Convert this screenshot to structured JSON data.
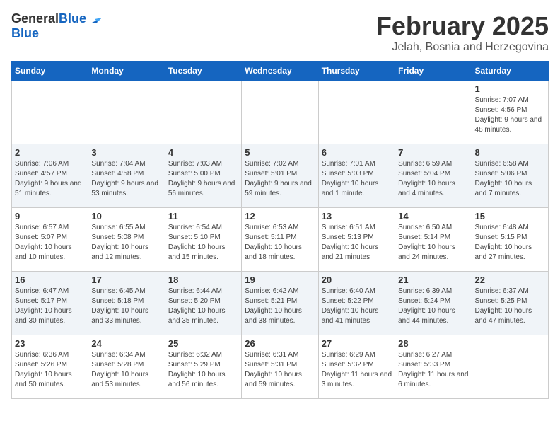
{
  "header": {
    "logo_general": "General",
    "logo_blue": "Blue",
    "month_title": "February 2025",
    "location": "Jelah, Bosnia and Herzegovina"
  },
  "days_of_week": [
    "Sunday",
    "Monday",
    "Tuesday",
    "Wednesday",
    "Thursday",
    "Friday",
    "Saturday"
  ],
  "weeks": [
    [
      {
        "day": "",
        "info": ""
      },
      {
        "day": "",
        "info": ""
      },
      {
        "day": "",
        "info": ""
      },
      {
        "day": "",
        "info": ""
      },
      {
        "day": "",
        "info": ""
      },
      {
        "day": "",
        "info": ""
      },
      {
        "day": "1",
        "info": "Sunrise: 7:07 AM\nSunset: 4:56 PM\nDaylight: 9 hours and 48 minutes."
      }
    ],
    [
      {
        "day": "2",
        "info": "Sunrise: 7:06 AM\nSunset: 4:57 PM\nDaylight: 9 hours and 51 minutes."
      },
      {
        "day": "3",
        "info": "Sunrise: 7:04 AM\nSunset: 4:58 PM\nDaylight: 9 hours and 53 minutes."
      },
      {
        "day": "4",
        "info": "Sunrise: 7:03 AM\nSunset: 5:00 PM\nDaylight: 9 hours and 56 minutes."
      },
      {
        "day": "5",
        "info": "Sunrise: 7:02 AM\nSunset: 5:01 PM\nDaylight: 9 hours and 59 minutes."
      },
      {
        "day": "6",
        "info": "Sunrise: 7:01 AM\nSunset: 5:03 PM\nDaylight: 10 hours and 1 minute."
      },
      {
        "day": "7",
        "info": "Sunrise: 6:59 AM\nSunset: 5:04 PM\nDaylight: 10 hours and 4 minutes."
      },
      {
        "day": "8",
        "info": "Sunrise: 6:58 AM\nSunset: 5:06 PM\nDaylight: 10 hours and 7 minutes."
      }
    ],
    [
      {
        "day": "9",
        "info": "Sunrise: 6:57 AM\nSunset: 5:07 PM\nDaylight: 10 hours and 10 minutes."
      },
      {
        "day": "10",
        "info": "Sunrise: 6:55 AM\nSunset: 5:08 PM\nDaylight: 10 hours and 12 minutes."
      },
      {
        "day": "11",
        "info": "Sunrise: 6:54 AM\nSunset: 5:10 PM\nDaylight: 10 hours and 15 minutes."
      },
      {
        "day": "12",
        "info": "Sunrise: 6:53 AM\nSunset: 5:11 PM\nDaylight: 10 hours and 18 minutes."
      },
      {
        "day": "13",
        "info": "Sunrise: 6:51 AM\nSunset: 5:13 PM\nDaylight: 10 hours and 21 minutes."
      },
      {
        "day": "14",
        "info": "Sunrise: 6:50 AM\nSunset: 5:14 PM\nDaylight: 10 hours and 24 minutes."
      },
      {
        "day": "15",
        "info": "Sunrise: 6:48 AM\nSunset: 5:15 PM\nDaylight: 10 hours and 27 minutes."
      }
    ],
    [
      {
        "day": "16",
        "info": "Sunrise: 6:47 AM\nSunset: 5:17 PM\nDaylight: 10 hours and 30 minutes."
      },
      {
        "day": "17",
        "info": "Sunrise: 6:45 AM\nSunset: 5:18 PM\nDaylight: 10 hours and 33 minutes."
      },
      {
        "day": "18",
        "info": "Sunrise: 6:44 AM\nSunset: 5:20 PM\nDaylight: 10 hours and 35 minutes."
      },
      {
        "day": "19",
        "info": "Sunrise: 6:42 AM\nSunset: 5:21 PM\nDaylight: 10 hours and 38 minutes."
      },
      {
        "day": "20",
        "info": "Sunrise: 6:40 AM\nSunset: 5:22 PM\nDaylight: 10 hours and 41 minutes."
      },
      {
        "day": "21",
        "info": "Sunrise: 6:39 AM\nSunset: 5:24 PM\nDaylight: 10 hours and 44 minutes."
      },
      {
        "day": "22",
        "info": "Sunrise: 6:37 AM\nSunset: 5:25 PM\nDaylight: 10 hours and 47 minutes."
      }
    ],
    [
      {
        "day": "23",
        "info": "Sunrise: 6:36 AM\nSunset: 5:26 PM\nDaylight: 10 hours and 50 minutes."
      },
      {
        "day": "24",
        "info": "Sunrise: 6:34 AM\nSunset: 5:28 PM\nDaylight: 10 hours and 53 minutes."
      },
      {
        "day": "25",
        "info": "Sunrise: 6:32 AM\nSunset: 5:29 PM\nDaylight: 10 hours and 56 minutes."
      },
      {
        "day": "26",
        "info": "Sunrise: 6:31 AM\nSunset: 5:31 PM\nDaylight: 10 hours and 59 minutes."
      },
      {
        "day": "27",
        "info": "Sunrise: 6:29 AM\nSunset: 5:32 PM\nDaylight: 11 hours and 3 minutes."
      },
      {
        "day": "28",
        "info": "Sunrise: 6:27 AM\nSunset: 5:33 PM\nDaylight: 11 hours and 6 minutes."
      },
      {
        "day": "",
        "info": ""
      }
    ]
  ]
}
